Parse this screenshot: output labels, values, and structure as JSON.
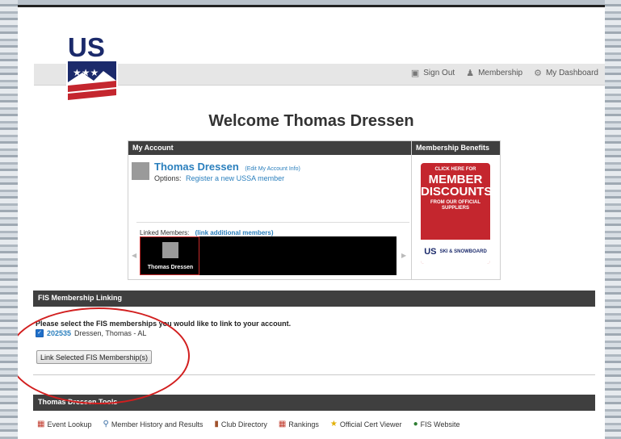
{
  "nav": {
    "sign_out": "Sign Out",
    "membership": "Membership",
    "dashboard": "My Dashboard"
  },
  "logo": {
    "text": "US"
  },
  "welcome": "Welcome Thomas Dressen",
  "my_account": {
    "title": "My Account",
    "name": "Thomas Dressen",
    "edit_link": "(Edit My Account Info)",
    "options_label": "Options:",
    "options_link": "Register a new USSA member",
    "linked_label": "Linked Members:",
    "linked_link": "(link additional members)",
    "linked_members": [
      {
        "name": "Thomas Dressen"
      }
    ]
  },
  "benefits": {
    "title": "Membership Benefits",
    "promo_click": "CLICK HERE FOR",
    "promo_member": "MEMBER",
    "promo_discounts": "DISCOUNTS",
    "promo_from": "FROM OUR OFFICIAL SUPPLIERS",
    "promo_us": "US",
    "promo_brand": "SKI & SNOWBOARD"
  },
  "fis": {
    "title": "FIS Membership Linking",
    "prompt": "Please select the FIS memberships you would like to link to your account.",
    "items": [
      {
        "id": "202535",
        "label": "Dressen, Thomas - AL",
        "checked": true
      }
    ],
    "button": "Link Selected FIS Membership(s)"
  },
  "tools": {
    "title": "Thomas Dressen Tools",
    "items": [
      {
        "label": "Event Lookup",
        "icon": "calendar-icon"
      },
      {
        "label": "Member History and Results",
        "icon": "magnifier-icon"
      },
      {
        "label": "Club Directory",
        "icon": "book-icon"
      },
      {
        "label": "Rankings",
        "icon": "calendar-icon"
      },
      {
        "label": "Official Cert Viewer",
        "icon": "star-icon"
      },
      {
        "label": "FIS Website",
        "icon": "globe-icon"
      }
    ]
  },
  "colors": {
    "link": "#2a7fbd",
    "header": "#3f3f3f",
    "annotation": "#d21f1f",
    "brand_red": "#c4262e",
    "brand_navy": "#1b2a6b"
  }
}
